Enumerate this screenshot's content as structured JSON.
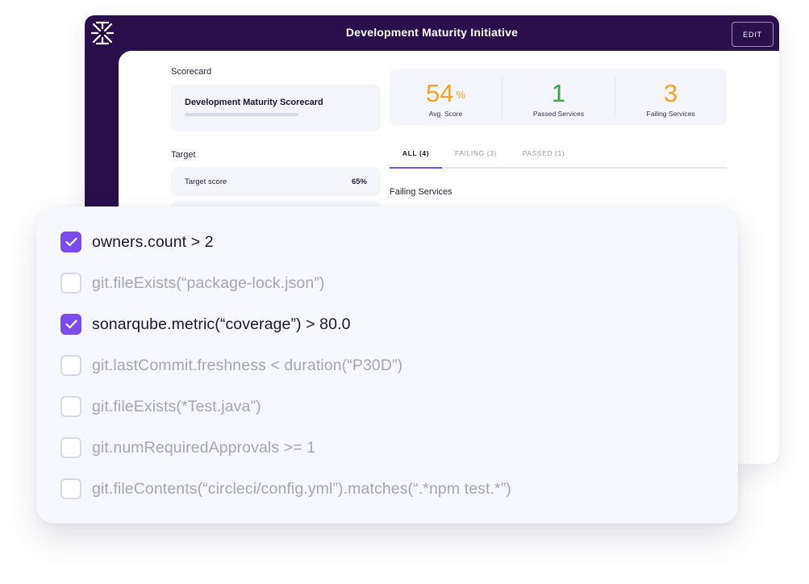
{
  "window": {
    "title": "Development Maturity Initiative",
    "edit_label": "EDIT",
    "logo_icon": "asterisk-x-logo",
    "brand_color": "#2a0f4d"
  },
  "scorecard": {
    "label": "Scorecard",
    "name": "Development Maturity Scorecard"
  },
  "target": {
    "label": "Target",
    "score_label": "Target score",
    "score_value": "65%"
  },
  "stats": {
    "avg_score": "54",
    "avg_score_unit": "%",
    "avg_score_label": "Avg. Score",
    "passed": "1",
    "passed_label": "Passed Services",
    "failing": "3",
    "failing_label": "Failing Services",
    "colors": {
      "score": "#f2a224",
      "passed": "#3aa64c",
      "failing": "#f2a224"
    }
  },
  "tabs": [
    {
      "label": "ALL (4)",
      "active": true
    },
    {
      "label": "FAILING (3)",
      "active": false
    },
    {
      "label": "PASSED (1)",
      "active": false
    }
  ],
  "failing_services_label": "Failing Services",
  "checklist": [
    {
      "rule": "owners.count > 2",
      "checked": true
    },
    {
      "rule": "git.fileExists(“package-lock.json”)",
      "checked": false
    },
    {
      "rule": "sonarqube.metric(“coverage”) > 80.0",
      "checked": true
    },
    {
      "rule": "git.lastCommit.freshness < duration(“P30D”)",
      "checked": false
    },
    {
      "rule": "git.fileExists(*Test.java”)",
      "checked": false
    },
    {
      "rule": "git.numRequiredApprovals >= 1",
      "checked": false
    },
    {
      "rule": "git.fileContents(“circleci/config.yml”).matches(“.*npm test.*”)",
      "checked": false
    }
  ]
}
